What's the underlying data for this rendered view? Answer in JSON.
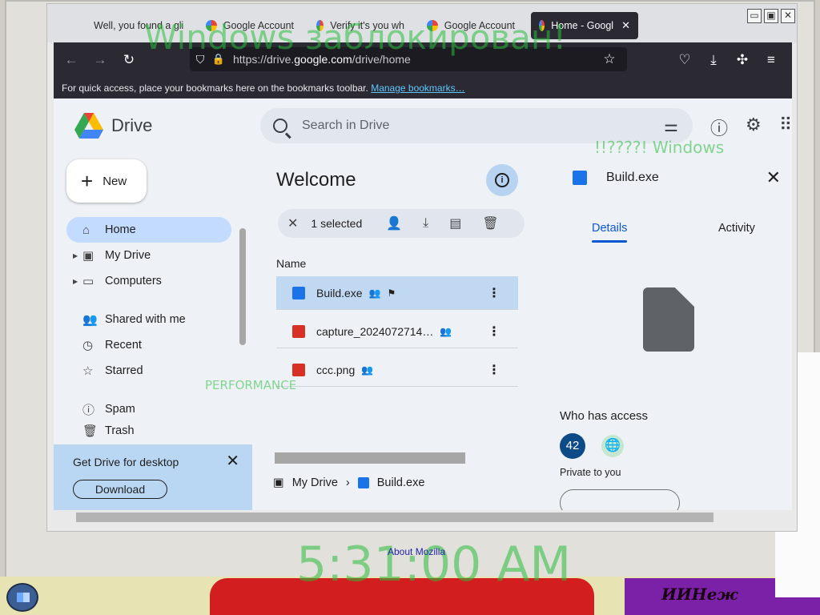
{
  "tabs": [
    {
      "label": "Well, you found a gli"
    },
    {
      "label": "Google Account"
    },
    {
      "label": "Verify it's you wh"
    },
    {
      "label": "Google Account"
    },
    {
      "label": "Home - Googl",
      "close": "✕"
    }
  ],
  "window_controls": [
    "▭",
    "▣",
    "✕",
    "✕"
  ],
  "navbar": {
    "url_prefix": "https://drive.",
    "url_host": "google.com",
    "url_path": "/drive/home"
  },
  "bookmarks": {
    "text": "For quick access, place your bookmarks here on the bookmarks toolbar.",
    "link": "Manage bookmarks…"
  },
  "drive": {
    "product": "Drive",
    "search_placeholder": "Search in Drive",
    "new_label": "New",
    "sidebar": [
      {
        "label": "Home",
        "icon": "⌂"
      },
      {
        "label": "My Drive",
        "icon": "▣"
      },
      {
        "label": "Computers",
        "icon": "▭"
      },
      {
        "label": "Shared with me",
        "icon": "👥"
      },
      {
        "label": "Recent",
        "icon": "◷"
      },
      {
        "label": "Starred",
        "icon": "☆"
      },
      {
        "label": "Spam",
        "icon": "ⓘ"
      },
      {
        "label": "Trash",
        "icon": "🗑"
      }
    ],
    "promo": {
      "title": "Get Drive for desktop",
      "button": "Download"
    },
    "main_title": "Welcome",
    "selection": {
      "count": "1 selected"
    },
    "column_name": "Name",
    "files": [
      {
        "name": "Build.exe",
        "selected": true
      },
      {
        "name": "capture_2024072714…",
        "selected": false
      },
      {
        "name": "ccc.png",
        "selected": false
      }
    ],
    "breadcrumb": {
      "root": "My Drive",
      "separator": "›",
      "current": "Build.exe"
    },
    "details": {
      "name": "Build.exe",
      "tab_details": "Details",
      "tab_activity": "Activity",
      "who_has_access": "Who has access",
      "avatar_count": "42",
      "private_text": "Private to you"
    }
  },
  "footer": {
    "about": "About Mozilla"
  },
  "ghosts": {
    "title": "Windows заблокирован!",
    "clock": "5:31:00 AM",
    "windows_line": "!!????! Windows",
    "perf": "PERFORMANCE"
  },
  "taskbar": {
    "purple_text": "ИИНеж"
  },
  "colors": {
    "accent": "#0b57d0",
    "selected_row": "#c0d8f2",
    "nav_dark": "#2b2a33",
    "ghost_green": "#28be3c"
  }
}
